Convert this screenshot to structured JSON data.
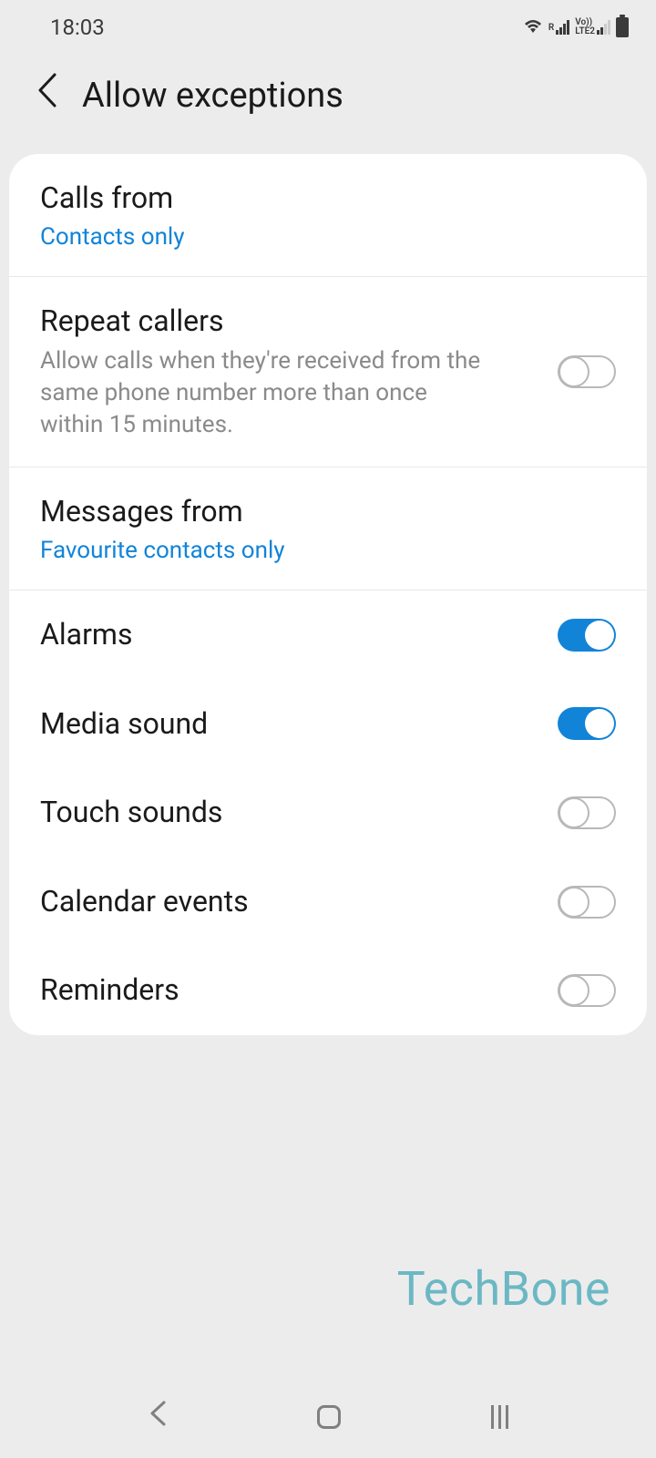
{
  "status": {
    "time": "18:03",
    "network": "LTE2",
    "volte": "Vo))"
  },
  "header": {
    "title": "Allow exceptions"
  },
  "settings": {
    "calls_from": {
      "title": "Calls from",
      "value": "Contacts only"
    },
    "repeat_callers": {
      "title": "Repeat callers",
      "desc": "Allow calls when they're received from the same phone number more than once within 15 minutes.",
      "enabled": false
    },
    "messages_from": {
      "title": "Messages from",
      "value": "Favourite contacts only"
    },
    "alarms": {
      "title": "Alarms",
      "enabled": true
    },
    "media_sound": {
      "title": "Media sound",
      "enabled": true
    },
    "touch_sounds": {
      "title": "Touch sounds",
      "enabled": false
    },
    "calendar_events": {
      "title": "Calendar events",
      "enabled": false
    },
    "reminders": {
      "title": "Reminders",
      "enabled": false
    }
  },
  "watermark": "TechBone"
}
